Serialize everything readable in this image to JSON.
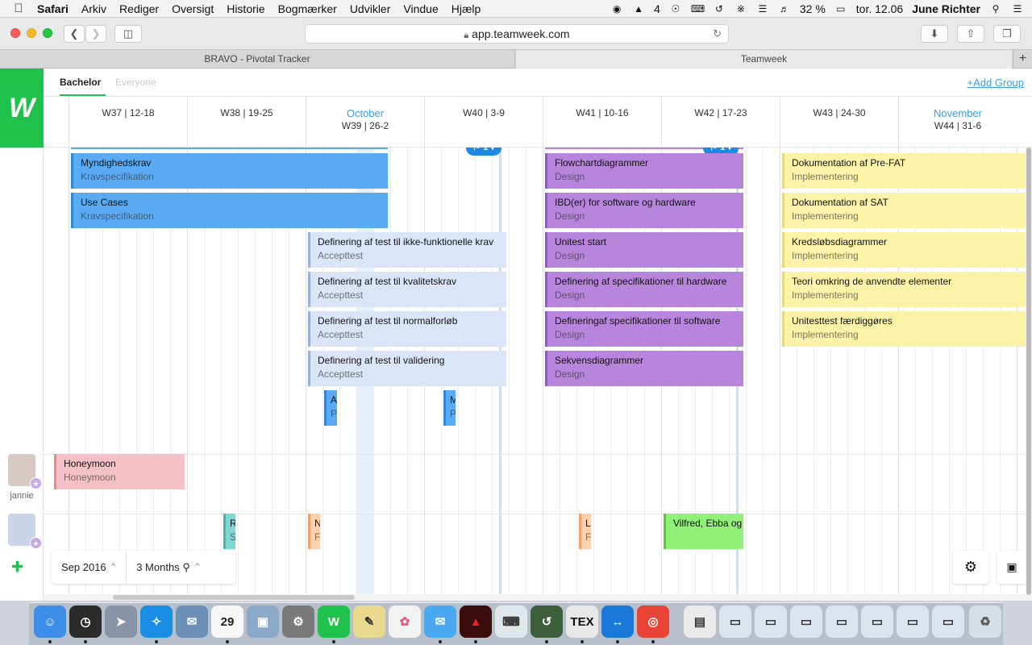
{
  "menubar": {
    "apple_icon": "apple-icon",
    "items": [
      "Safari",
      "Arkiv",
      "Rediger",
      "Oversigt",
      "Historie",
      "Bogmærker",
      "Udvikler",
      "Vindue",
      "Hjælp"
    ],
    "status_value": "4",
    "battery": "32 %",
    "clock": "tor. 12.06",
    "user": "June Richter"
  },
  "browser": {
    "url": "app.teamweek.com",
    "tabs": [
      "BRAVO - Pivotal Tracker",
      "Teamweek"
    ]
  },
  "app": {
    "logo": "W",
    "groups": [
      "Bachelor",
      "Everyone"
    ],
    "add_group": "+Add Group",
    "weeks": [
      {
        "month": "",
        "label": "W37 | 12-18"
      },
      {
        "month": "",
        "label": "W38 | 19-25"
      },
      {
        "month": "October",
        "label": "W39 | 26-2"
      },
      {
        "month": "",
        "label": "W40 | 3-9"
      },
      {
        "month": "",
        "label": "W41 | 10-16"
      },
      {
        "month": "",
        "label": "W42 | 17-23"
      },
      {
        "month": "",
        "label": "W43 | 24-30"
      },
      {
        "month": "November",
        "label": "W44 | 31-6"
      }
    ],
    "flags": [
      "1",
      "1"
    ],
    "tasks": [
      {
        "title": "Myndighedskrav",
        "project": "Kravspecifikation"
      },
      {
        "title": "Use Cases",
        "project": "Kravspecifikation"
      },
      {
        "title": "Definering af test til ikke-funktionelle krav",
        "project": "Accepttest"
      },
      {
        "title": "Definering af test til kvalitetskrav",
        "project": "Accepttest"
      },
      {
        "title": "Definering af test til normalforløb",
        "project": "Accepttest"
      },
      {
        "title": "Definering af test til validering",
        "project": "Accepttest"
      },
      {
        "title": "A",
        "project": "P"
      },
      {
        "title": "M",
        "project": "P"
      },
      {
        "title": "Flowchartdiagrammer",
        "project": "Design"
      },
      {
        "title": "IBD(er) for software og hardware",
        "project": "Design"
      },
      {
        "title": "Unitest start",
        "project": "Design"
      },
      {
        "title": "Definering af specifikationer til hardware",
        "project": "Design"
      },
      {
        "title": "Defineringaf specifikationer til software",
        "project": "Design"
      },
      {
        "title": "Sekvensdiagrammer",
        "project": "Design"
      },
      {
        "title": "Dokumentation af Pre-FAT",
        "project": "Implementering"
      },
      {
        "title": "Dokumentation af SAT",
        "project": "Implementering"
      },
      {
        "title": "Kredsløbsdiagrammer",
        "project": "Implementering"
      },
      {
        "title": "Teori omkring de anvendte elementer",
        "project": "Implementering"
      },
      {
        "title": "Unitesttest færdiggøres",
        "project": "Implementering"
      },
      {
        "title": "Honeymoon",
        "project": "Honeymoon"
      },
      {
        "title": "R",
        "project": "S"
      },
      {
        "title": "N",
        "project": "F"
      },
      {
        "title": "L",
        "project": "F"
      },
      {
        "title": "Vilfred, Ebba og",
        "project": ""
      }
    ],
    "people": [
      {
        "name": "jannie"
      },
      {
        "name": ""
      }
    ],
    "controls": {
      "date": "Sep 2016",
      "range": "3 Months"
    }
  },
  "colors": {
    "brand": "#1fc24a",
    "accent": "#3a9ee4",
    "kravspecifikation": "#5aabf3",
    "accepttest": "#dbe5f8",
    "design": "#b786dc",
    "implementering": "#fcf3a9",
    "honeymoon": "#f6c1c6"
  },
  "dock": [
    "finder-icon",
    "dashboard-icon",
    "launchpad-icon",
    "safari-icon",
    "mail-icon",
    "calendar-icon",
    "preview-icon",
    "system-preferences-icon",
    "teamweek-icon",
    "notes-icon",
    "photos-icon",
    "messages-icon",
    "acrobat-icon",
    "keyboard-icon",
    "time-machine-icon",
    "tex-icon",
    "teamviewer-icon",
    "chrome-icon",
    "textedit-icon",
    "trash-icon"
  ]
}
